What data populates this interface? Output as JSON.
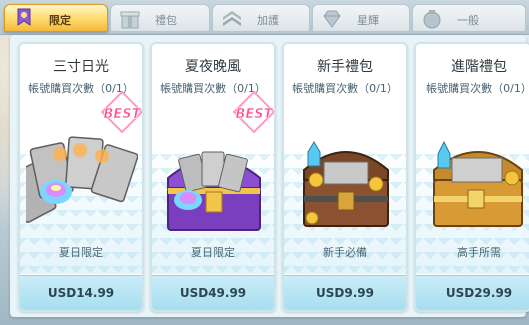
{
  "tabs": [
    {
      "label": "限定",
      "icon": "ribbon-icon",
      "active": true
    },
    {
      "label": "禮包",
      "icon": "gift-box-icon",
      "active": false
    },
    {
      "label": "加護",
      "icon": "chevron-rank-icon",
      "active": false
    },
    {
      "label": "星輝",
      "icon": "gem-icon",
      "active": false
    },
    {
      "label": "一般",
      "icon": "coin-bag-icon",
      "active": false
    }
  ],
  "cards": [
    {
      "title": "三寸日光",
      "limit": "帳號購買次數（0/1）",
      "tag": "夏日限定",
      "price": "USD14.99",
      "best": "BEST",
      "art": "card-fan"
    },
    {
      "title": "夏夜晚風",
      "limit": "帳號購買次數（0/1）",
      "tag": "夏日限定",
      "price": "USD49.99",
      "best": "BEST",
      "art": "purple-chest"
    },
    {
      "title": "新手禮包",
      "limit": "帳號購買次數（0/1）",
      "tag": "新手必備",
      "price": "USD9.99",
      "art": "treasure-chest"
    },
    {
      "title": "進階禮包",
      "limit": "帳號購買次數（0/1）",
      "tag": "高手所需",
      "price": "USD29.99",
      "art": "gold-chest"
    }
  ],
  "colors": {
    "active_tab": "#ffd86a",
    "price_bar": "#a7def0",
    "best_badge": "#ff6fa8"
  }
}
